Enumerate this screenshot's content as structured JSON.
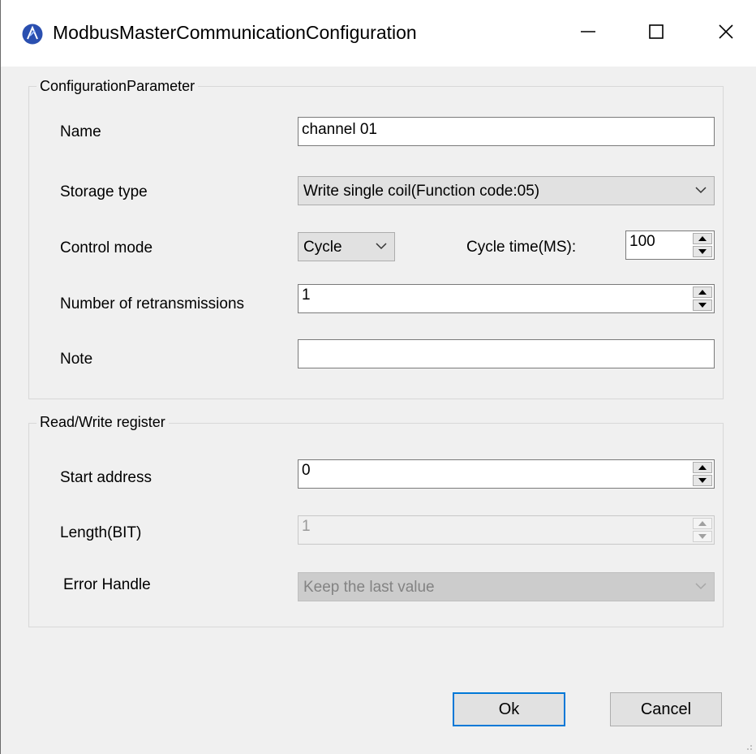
{
  "window": {
    "title": "ModbusMasterCommunicationConfiguration",
    "icon": "app-logo-icon",
    "controls": [
      "minimize-icon",
      "maximize-icon",
      "close-icon"
    ]
  },
  "config_group": {
    "title": "ConfigurationParameter",
    "name_label": "Name",
    "name_value": "channel 01",
    "storage_label": "Storage type",
    "storage_value": "Write single coil(Function code:05)",
    "control_label": "Control mode",
    "control_value": "Cycle",
    "cycle_label": "Cycle time(MS):",
    "cycle_value": "100",
    "retrans_label": "Number of retransmissions",
    "retrans_value": "1",
    "note_label": "Note",
    "note_value": ""
  },
  "rw_group": {
    "title": "Read/Write register",
    "start_label": "Start address",
    "start_value": "0",
    "length_label": "Length(BIT)",
    "length_value": "1",
    "error_label": "Error Handle",
    "error_value": "Keep the last value"
  },
  "buttons": {
    "ok": "Ok",
    "cancel": "Cancel"
  },
  "colors": {
    "accent": "#0078d7",
    "dialog_bg": "#f0f0f0"
  }
}
